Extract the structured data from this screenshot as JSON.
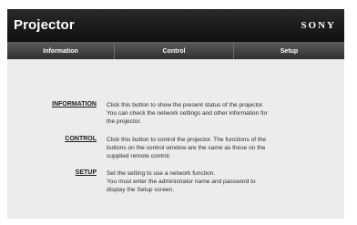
{
  "header": {
    "title": "Projector",
    "brand": "SONY"
  },
  "tabs": [
    {
      "label": "Information"
    },
    {
      "label": "Control"
    },
    {
      "label": "Setup"
    }
  ],
  "sections": [
    {
      "link": "INFORMATION",
      "lines": [
        "Click this button to show the present status of the projector.",
        "You can check the network settings and other information for",
        "the projector."
      ]
    },
    {
      "link": "CONTROL",
      "lines": [
        "Click this button to control the projector. The functions of the",
        "buttons on the control window are the same as those on the",
        "supplied remote control."
      ]
    },
    {
      "link": "SETUP",
      "lines": [
        "Set the setting to use a network function.",
        "You must enter the administrator name and password to",
        "display the Setup screen."
      ]
    }
  ]
}
